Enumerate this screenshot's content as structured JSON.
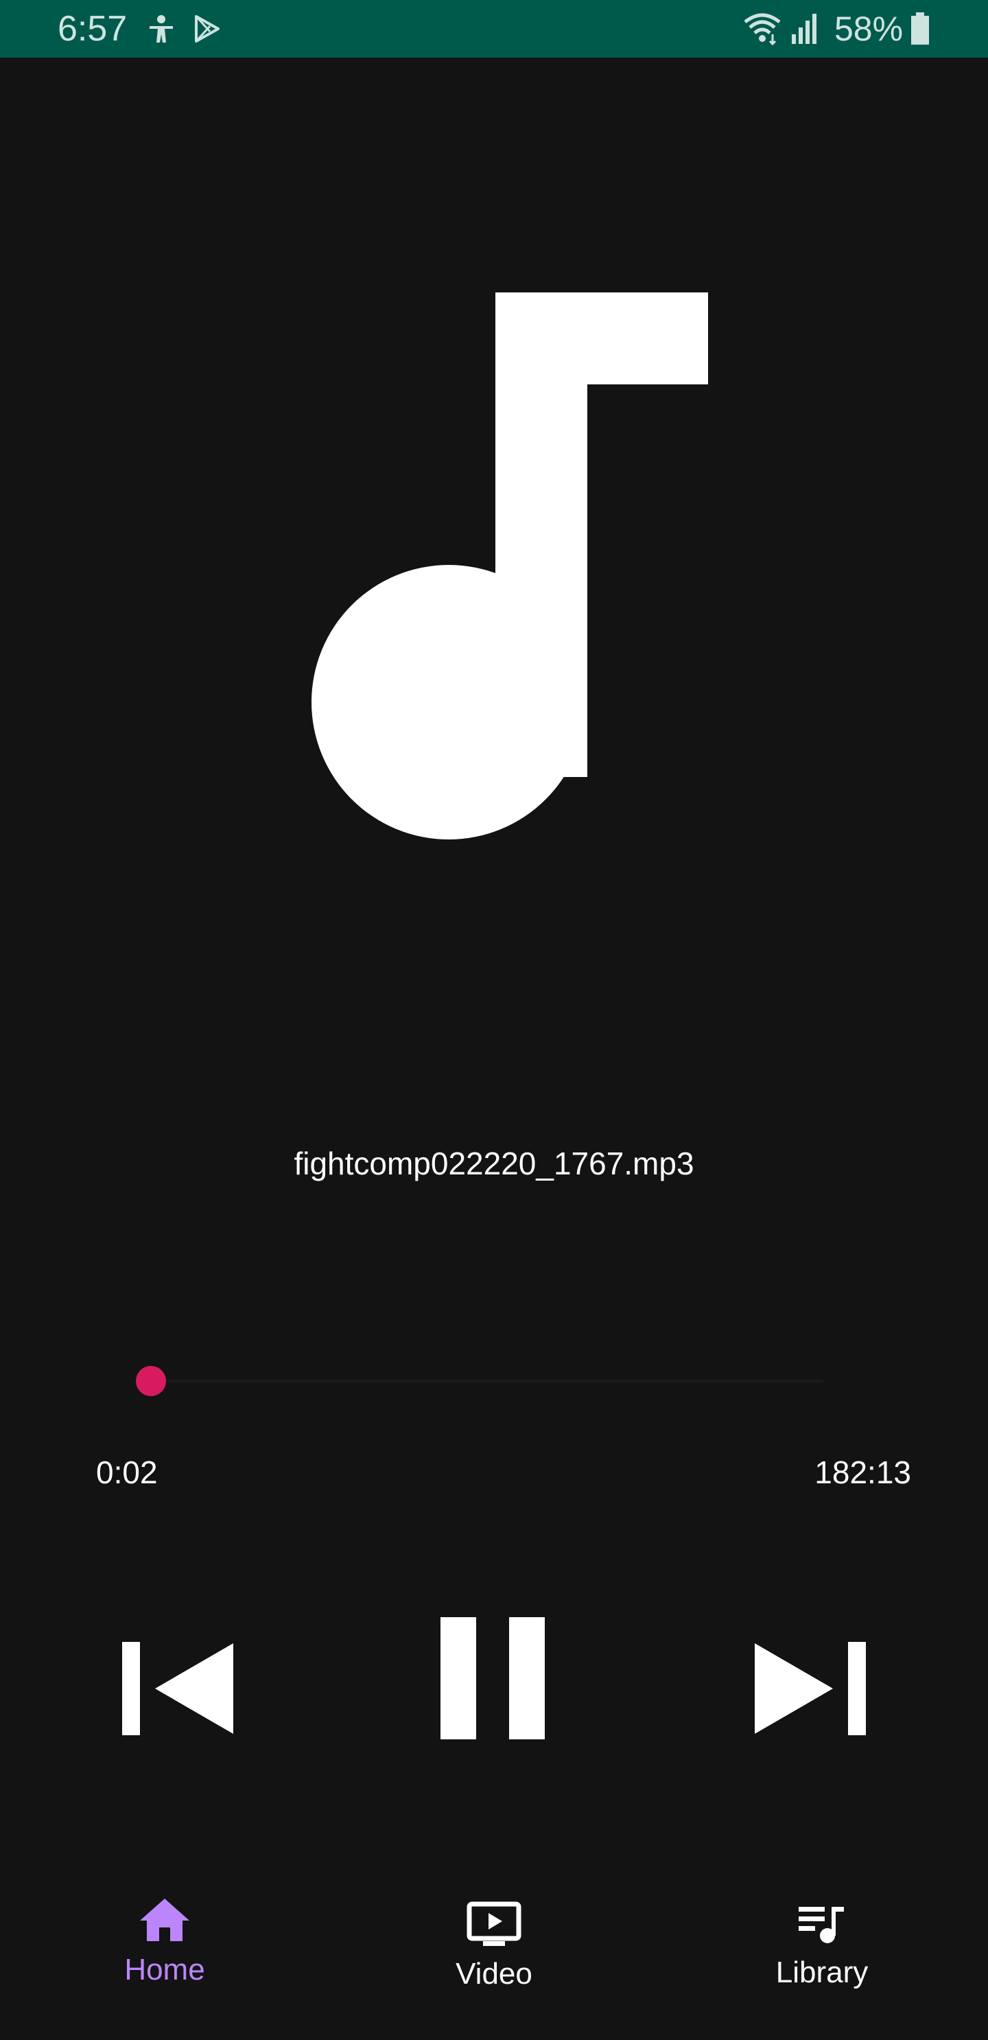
{
  "status_bar": {
    "time": "6:57",
    "battery": "58%",
    "icons": [
      "accessibility-icon",
      "play-store-icon",
      "wifi-icon",
      "signal-icon",
      "battery-icon"
    ]
  },
  "player": {
    "album_art_icon": "music-note-icon",
    "track_title": "fightcomp022220_1767.mp3",
    "elapsed": "0:02",
    "total": "182:13",
    "progress": 0.0002,
    "accent_color": "#d81b60"
  },
  "controls": {
    "previous_icon": "skip-previous-icon",
    "pause_icon": "pause-icon",
    "next_icon": "skip-next-icon"
  },
  "bottom_nav": {
    "items": [
      {
        "label": "Home",
        "icon": "home-icon",
        "active": true
      },
      {
        "label": "Video",
        "icon": "video-icon",
        "active": false
      },
      {
        "label": "Library",
        "icon": "library-music-icon",
        "active": false
      }
    ],
    "active_color": "#bb86fc"
  }
}
